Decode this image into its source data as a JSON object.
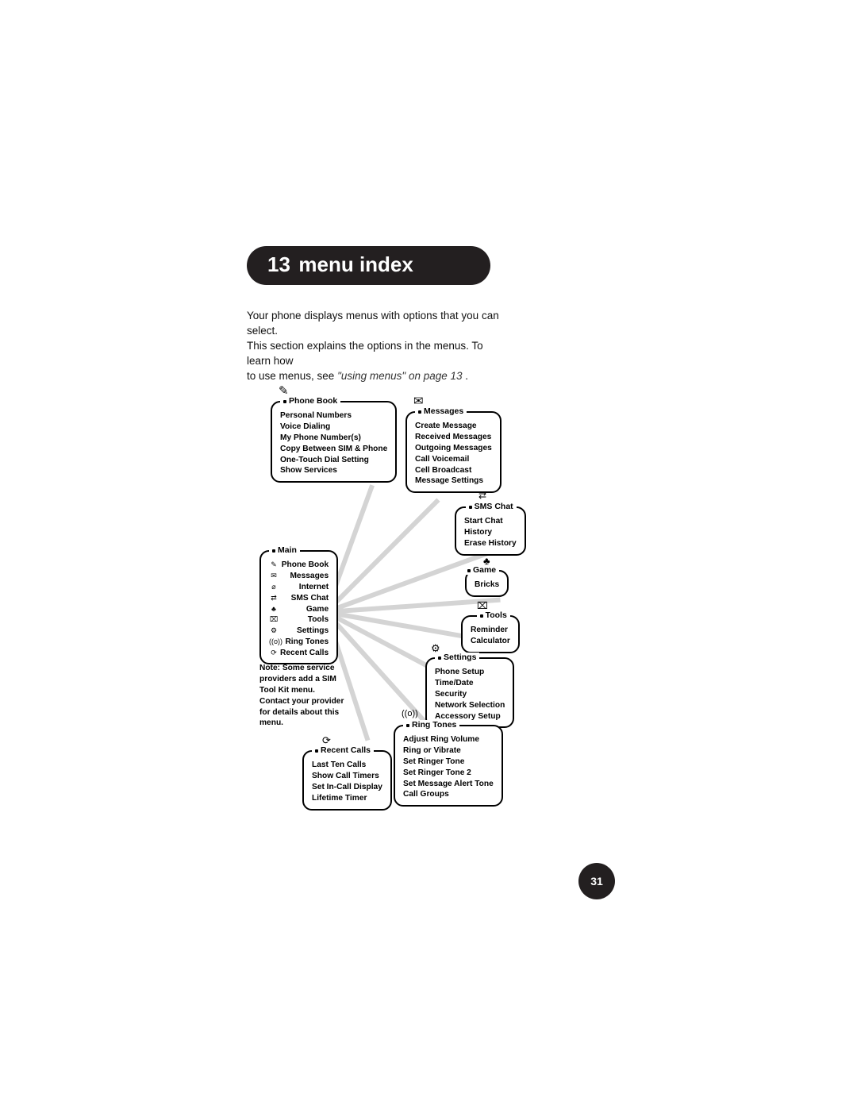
{
  "chapter": {
    "number": "13",
    "title": "menu index"
  },
  "intro": {
    "l1": "Your phone displays menus with options that you can select.",
    "l2": "This section explains the options in the menus. To learn how",
    "l3a": "to use menus, see ",
    "l3link": "\"using menus\" on page 13",
    "l3b": " ."
  },
  "note": "Note: Some service providers add a SIM Tool Kit menu. Contact your provider for details about this menu.",
  "page_number": "31",
  "boxes": {
    "main": {
      "title": "Main",
      "items": [
        "Phone Book",
        "Messages",
        "Internet",
        "SMS Chat",
        "Game",
        "Tools",
        "Settings",
        "Ring Tones",
        "Recent Calls"
      ],
      "icons": [
        "✎",
        "✉",
        "⌀",
        "⇄",
        "♣",
        "⌧",
        "⚙",
        "((o))",
        "⟳"
      ]
    },
    "phonebook": {
      "title": "Phone Book",
      "items": [
        "Personal Numbers",
        "Voice Dialing",
        "My Phone Number(s)",
        "Copy Between SIM & Phone",
        "One-Touch Dial Setting",
        "Show Services"
      ]
    },
    "messages": {
      "title": "Messages",
      "items": [
        "Create Message",
        "Received Messages",
        "Outgoing Messages",
        "Call Voicemail",
        "Cell Broadcast",
        "Message Settings"
      ]
    },
    "smschat": {
      "title": "SMS Chat",
      "items": [
        "Start Chat",
        "History",
        "Erase History"
      ]
    },
    "game": {
      "title": "Game",
      "items": [
        "Bricks"
      ]
    },
    "tools": {
      "title": "Tools",
      "items": [
        "Reminder",
        "Calculator"
      ]
    },
    "settings": {
      "title": "Settings",
      "items": [
        "Phone Setup",
        "Time/Date",
        "Security",
        "Network Selection",
        "Accessory Setup"
      ]
    },
    "ringtones": {
      "title": "Ring Tones",
      "items": [
        "Adjust Ring Volume",
        "Ring or Vibrate",
        "Set Ringer Tone",
        "Set Ringer Tone 2",
        "Set Message Alert Tone",
        "Call Groups"
      ]
    },
    "recent": {
      "title": "Recent Calls",
      "items": [
        "Last Ten Calls",
        "Show Call Timers",
        "Set In-Call Display",
        "Lifetime Timer"
      ]
    }
  },
  "icons_above": {
    "phonebook": "✎",
    "messages": "✉",
    "smschat": "⇄",
    "game": "♣",
    "tools": "⌧",
    "settings": "⚙",
    "ringtones": "((o))",
    "recent": "⟳"
  }
}
